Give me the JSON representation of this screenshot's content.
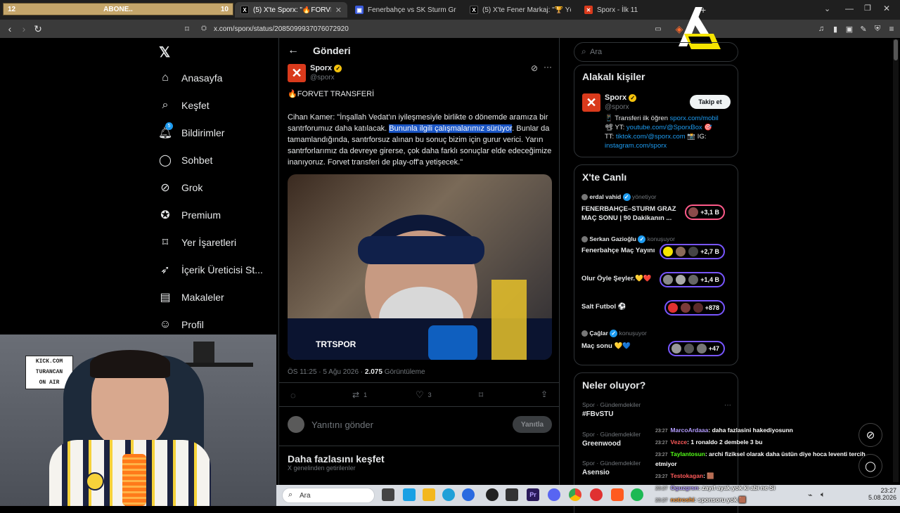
{
  "browser": {
    "overlay_bar": {
      "left": "12",
      "center": "ABONE..",
      "right": "10"
    },
    "tabs": [
      {
        "title": "(5) X'te Sporx: \"🔥FORVET TRAN",
        "active": true
      },
      {
        "title": "Fenerbahçe vs SK Sturm Graz live sco",
        "active": false
      },
      {
        "title": "(5) X'te Fener Markaj: \"🏆 Yöneticim",
        "active": false
      },
      {
        "title": "Sporx - İlk 11",
        "active": false
      }
    ],
    "new_tab": "+",
    "url": "x.com/sporx/status/2085099937076072920"
  },
  "nav": {
    "items": [
      {
        "label": "Anasayfa",
        "icon": "home-icon"
      },
      {
        "label": "Keşfet",
        "icon": "search-icon"
      },
      {
        "label": "Bildirimler",
        "icon": "bell-icon",
        "badge": "5"
      },
      {
        "label": "Sohbet",
        "icon": "chat-icon"
      },
      {
        "label": "Grok",
        "icon": "grok-icon"
      },
      {
        "label": "Premium",
        "icon": "premium-icon"
      },
      {
        "label": "Yer İşaretleri",
        "icon": "bookmark-icon"
      },
      {
        "label": "İçerik Üreticisi St...",
        "icon": "rocket-icon"
      },
      {
        "label": "Makaleler",
        "icon": "article-icon"
      },
      {
        "label": "Profil",
        "icon": "profile-icon"
      }
    ]
  },
  "post": {
    "header": "Gönderi",
    "author_name": "Sporx",
    "author_handle": "@sporx",
    "headline": "🔥FORVET TRANSFERİ",
    "body_1": "Cihan Kamer: \"İnşallah Vedat'ın iyileşmesiyle birlikte o dönemde aramıza bir santrforumuz daha katılacak. ",
    "body_highlight": "Bununla ilgili çalışmalarımız sürüyor",
    "body_2": ". Bunlar da tamamlandığında, santrfors­uz alınan bu sonuç bizim için gurur verici. Yarın santrforlarımız da devreye girerse, çok daha farklı sonuçlar elde edeceğimize inanıyoruz. Forvet transferi de play-off'a yetişecek.\"",
    "meta_time": "ÖS 11:25 · 5 Ağu 2026 · ",
    "views": "2.075",
    "views_label": " Görüntüleme",
    "retweets": "1",
    "likes": "3",
    "reply_placeholder": "Yanıtını gönder",
    "reply_button": "Yanıtla",
    "more_title": "Daha fazlasını keşfet",
    "more_sub": "X genelinden getirilenler"
  },
  "right": {
    "search_placeholder": "Ara",
    "related_title": "Alakalı kişiler",
    "related_name": "Sporx",
    "related_handle": "@sporx",
    "follow_label": "Takip et",
    "bio_1": "📱 Transferi ilk öğren ",
    "bio_link1": "sporx.com/mobil",
    "bio_2": "📽 YT: ",
    "bio_link2": "youtube.com/@SporxBox",
    "bio_3": "TT: ",
    "bio_link3": "tiktok.com/@sporx.com",
    "bio_4": " 📸 IG:",
    "bio_link4": "instagram.com/sporx",
    "live_title": "X'te Canlı",
    "live": [
      {
        "host": "erdal vahid",
        "role": "yönetiyor",
        "title": "FENERBAHÇE–STURM GRAZ MAÇ SONU | 90 Dakikanın ...",
        "count": "+3,1 B"
      },
      {
        "host": "Serkan Gazioğlu",
        "role": "konuşuyor",
        "title": "Fenerbahçe Maç Yayını",
        "count": "+2,7 B"
      },
      {
        "host": "",
        "role": "",
        "title": "Olur Öyle Şeyler.💛❤️",
        "count": "+1,4 B"
      },
      {
        "host": "",
        "role": "",
        "title": "Salt Futbol ⚽",
        "count": "+878"
      },
      {
        "host": "Çağlar",
        "role": "konuşuyor",
        "title": "Maç sonu 💛💙",
        "count": "+47"
      }
    ],
    "trends_title": "Neler oluyor?",
    "trends": [
      {
        "cat": "Spor · Gündemdekiler",
        "name": "#FBvSTU"
      },
      {
        "cat": "Spor · Gündemdekiler",
        "name": "Greenwood"
      },
      {
        "cat": "Spor · Gündemdekiler",
        "name": "Asensio"
      }
    ]
  },
  "webcam": {
    "sign_1": "KICK.COM",
    "sign_2": "TURANCAN",
    "sign_3": "ON AIR"
  },
  "chat": [
    {
      "time": "23:27",
      "user": "MarcoArdaaa",
      "color": "#b39cff",
      "msg": ": daha fazlasini hakediyosunn"
    },
    {
      "time": "23:27",
      "user": "Vezce",
      "color": "#ff5a5a",
      "msg": ": 1 ronaldo 2 dembele 3 bu"
    },
    {
      "time": "23:27",
      "user": "Taylantosun",
      "color": "#53fc18",
      "msg": ": archi fiziksel olarak daha üstün diye hoca leventi tercih"
    },
    {
      "time": "",
      "user": "",
      "color": "#fff",
      "msg": "etmiyor"
    },
    {
      "time": "23:27",
      "user": "Testokagan",
      "color": "#ff5a5a",
      "msg": ": 🟫"
    },
    {
      "time": "23:27",
      "user": "Oguzgrsn",
      "color": "#b39cff",
      "msg": ": zayıf ayak yok ki abi ne Si"
    },
    {
      "time": "23:27",
      "user": "notroshi",
      "color": "#ff9f40",
      "msg": ": sponsoru yok 🟫"
    }
  ],
  "taskbar": {
    "search": "Ara",
    "time": "23:27",
    "date": "5.08.2026"
  }
}
